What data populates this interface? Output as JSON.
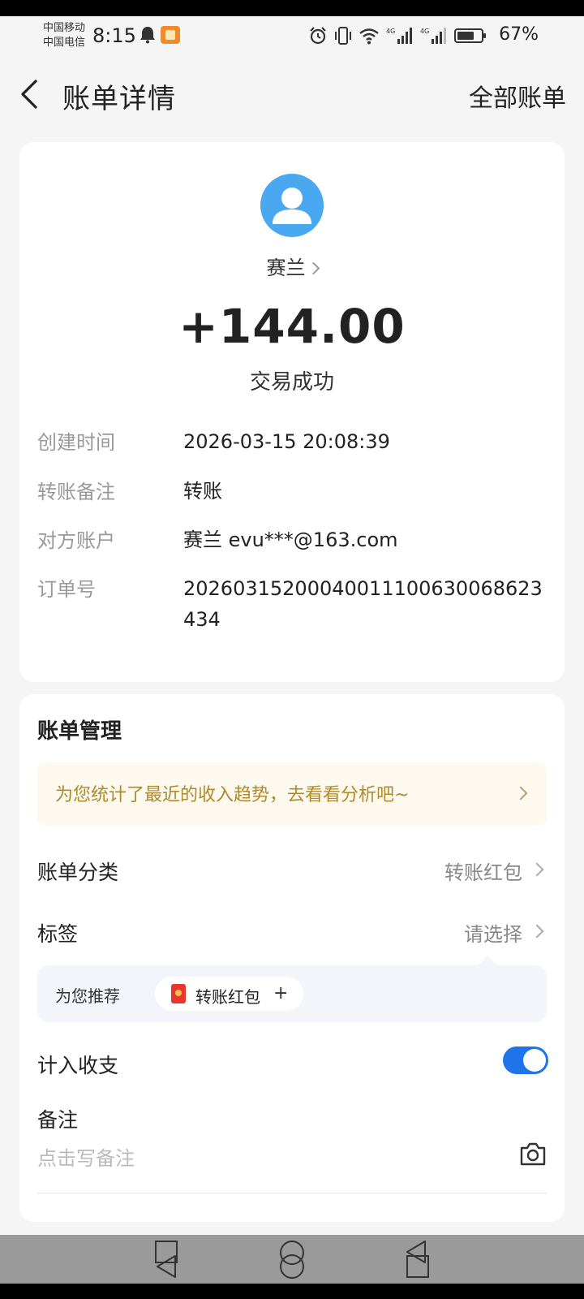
{
  "status_bar": {
    "carrier1": "中国移动",
    "carrier2": "中国电信",
    "time": "8:15",
    "battery": "67%",
    "icons": [
      "bell-icon",
      "app-notification-icon",
      "alarm-icon",
      "vibrate-icon",
      "wifi-icon",
      "signal-4g-icon",
      "signal-4g-icon",
      "battery-icon"
    ]
  },
  "header": {
    "title": "账单详情",
    "right_link": "全部账单"
  },
  "transaction": {
    "payer": "赛兰",
    "amount": "+144.00",
    "status": "交易成功",
    "details": [
      {
        "label": "创建时间",
        "value": "2026-03-15 20:08:39"
      },
      {
        "label": "转账备注",
        "value": "转账"
      },
      {
        "label": "对方账户",
        "value": "赛兰 evu***@163.com"
      },
      {
        "label": "订单号",
        "value": "20260315200040011100630068623434"
      }
    ]
  },
  "management": {
    "title": "账单管理",
    "banner": "为您统计了最近的收入趋势，去看看分析吧~",
    "category_label": "账单分类",
    "category_value": "转账红包",
    "tag_label": "标签",
    "tag_value": "请选择",
    "recommend_label": "为您推荐",
    "recommend_chip": "转账红包",
    "recommend_add": "+",
    "include_label": "计入收支",
    "include_enabled": true,
    "note_label": "备注",
    "note_placeholder": "点击写备注",
    "note_value": ""
  },
  "colors": {
    "accent": "#1e74e8",
    "avatar": "#4aa8f0",
    "banner_text": "#b08a2a",
    "banner_bg": "#fdf9ef",
    "red_packet": "#e8352e"
  }
}
